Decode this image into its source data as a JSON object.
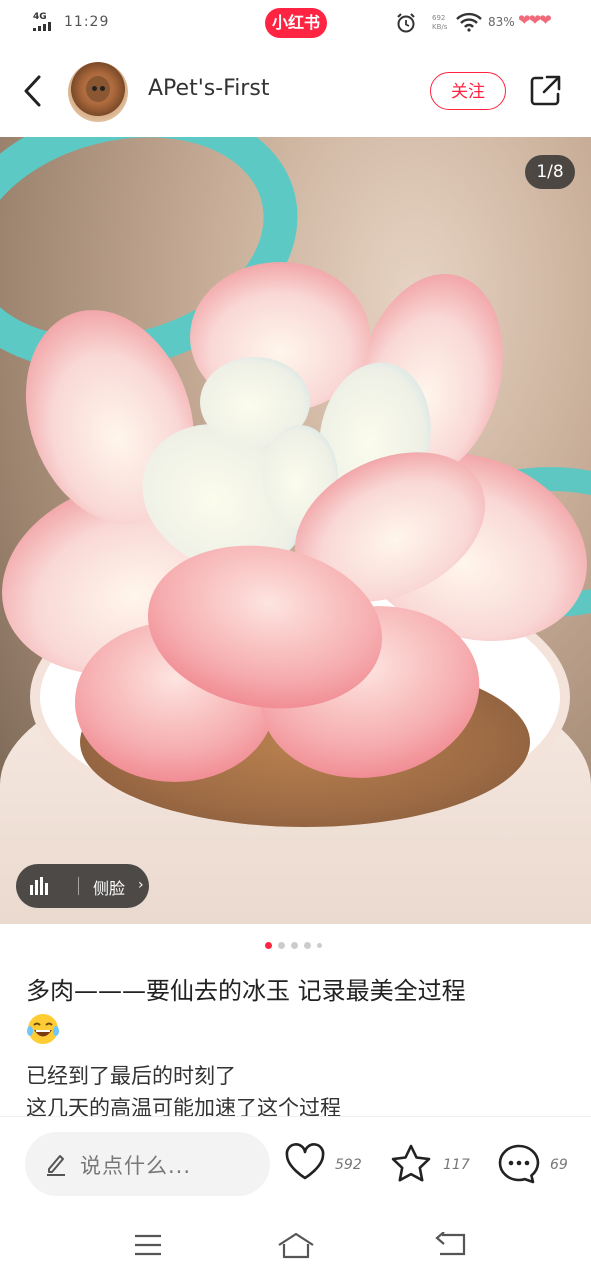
{
  "status_bar": {
    "network": "4G",
    "time": "11:29",
    "app_logo": "小红书",
    "net_speed_top": "692",
    "net_speed_bottom": "KB/s",
    "battery": "83%",
    "icons": [
      "signal-icon",
      "alarm-icon",
      "wifi-icon",
      "hearts-icon"
    ]
  },
  "header": {
    "username": "APet's-First",
    "follow_label": "关注",
    "icons": [
      "back-icon",
      "share-icon"
    ]
  },
  "photo": {
    "counter": "1/8",
    "tag_label": "侧脸",
    "dots_total": 5,
    "dots_active": 0
  },
  "post": {
    "title": "多肉———要仙去的冰玉 记录最美全过程",
    "emoji": "laughing-crying-emoji",
    "body_line1": "已经到了最后的时刻了",
    "body_line2": "这几天的高温可能加速了这个过程"
  },
  "actions": {
    "comment_placeholder": "说点什么...",
    "likes": "592",
    "favorites": "117",
    "comments": "69"
  },
  "colors": {
    "accent": "#ff2442",
    "text": "#222222",
    "secondary": "#777777"
  }
}
